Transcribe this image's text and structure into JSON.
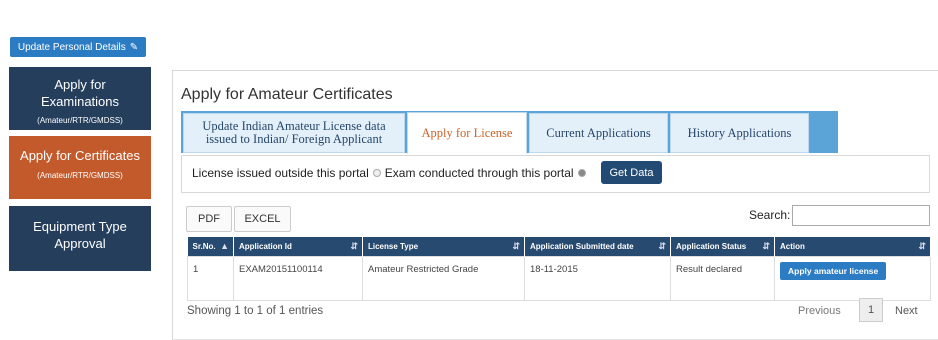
{
  "top_button": {
    "label": "Update Personal Details",
    "icon": "edit-icon"
  },
  "sidebar": {
    "items": [
      {
        "label_line1": "Apply for",
        "label_line2": "Examinations",
        "sub": "(Amateur/RTR/GMDSS)",
        "bg": "#243e5c"
      },
      {
        "label_line1": "Apply for Certificates",
        "label_line2": "",
        "sub": "(Amateur/RTR/GMDSS)",
        "bg": "#c35a2b"
      },
      {
        "label_line1": "Equipment Type",
        "label_line2": "Approval",
        "sub": "",
        "bg": "#243e5c"
      }
    ]
  },
  "main": {
    "title": "Apply for Amateur Certificates",
    "tabs": [
      {
        "label": "Update Indian Amateur License data issued to Indian/ Foreign Applicant",
        "active": false
      },
      {
        "label": "Apply for License",
        "active": true
      },
      {
        "label": "Current Applications",
        "active": false
      },
      {
        "label": "History Applications",
        "active": false
      }
    ],
    "filter": {
      "option1": "License issued outside this portal",
      "option2": "Exam conducted through this portal",
      "selected": "option2",
      "get_data_label": "Get Data"
    },
    "export": {
      "pdf": "PDF",
      "excel": "EXCEL"
    },
    "search": {
      "label": "Search:",
      "value": ""
    },
    "table": {
      "columns": [
        "Sr.No.",
        "Application Id",
        "License Type",
        "Application Submitted date",
        "Application Status",
        "Action"
      ],
      "rows": [
        {
          "sr": "1",
          "app_id": "EXAM20151100114",
          "license_type": "Amateur Restricted Grade",
          "date": "18-11-2015",
          "status": "Result declared",
          "action": "Apply amateur license"
        }
      ]
    },
    "footer": {
      "showing": "Showing 1 to 1 of 1 entries",
      "previous": "Previous",
      "page": "1",
      "next": "Next"
    }
  },
  "colors": {
    "navy": "#243e5c",
    "accent_orange": "#c35a2b",
    "blue_button": "#2c7cc4",
    "tab_bar": "#5aa4d8"
  }
}
